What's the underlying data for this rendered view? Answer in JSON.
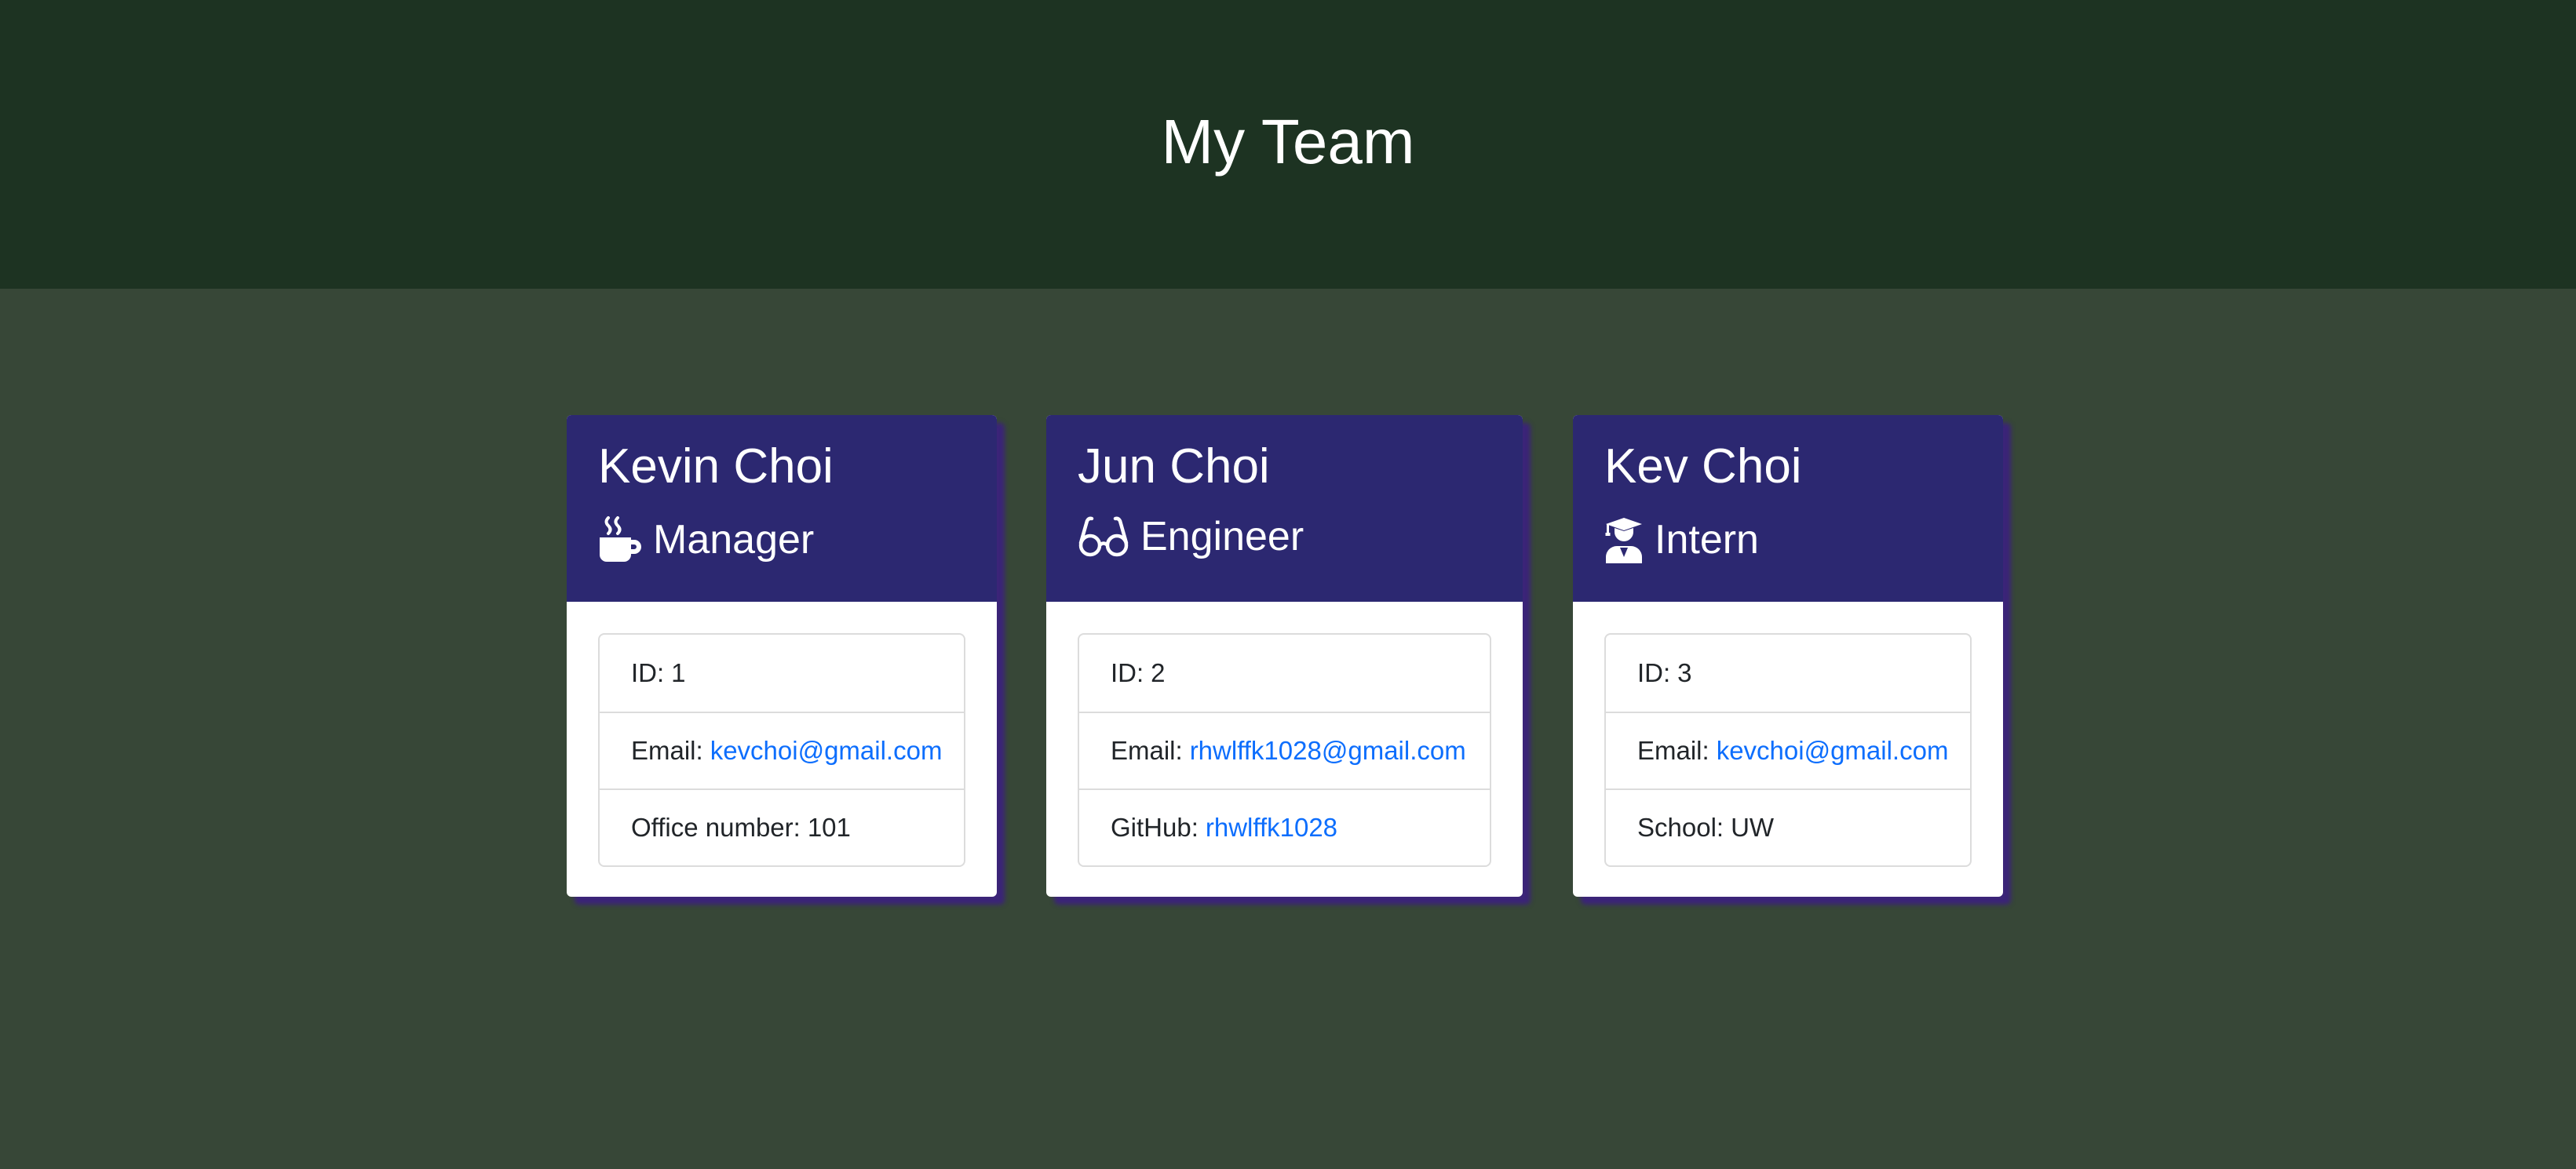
{
  "header": {
    "title": "My Team"
  },
  "cards": [
    {
      "name": "Kevin Choi",
      "role": "Manager",
      "role_icon": "mug-hot-icon",
      "id_label": "ID:",
      "id_value": "1",
      "email_label": "Email:",
      "email_value": "kevchoi@gmail.com",
      "extra_label": "Office number:",
      "extra_value": "101"
    },
    {
      "name": "Jun Choi",
      "role": "Engineer",
      "role_icon": "glasses-icon",
      "id_label": "ID:",
      "id_value": "2",
      "email_label": "Email:",
      "email_value": "rhwlffk1028@gmail.com",
      "extra_label": "GitHub:",
      "extra_value": "rhwlffk1028"
    },
    {
      "name": "Kev Choi",
      "role": "Intern",
      "role_icon": "user-graduate-icon",
      "id_label": "ID:",
      "id_value": "3",
      "email_label": "Email:",
      "email_value": "kevchoi@gmail.com",
      "extra_label": "School:",
      "extra_value": "UW"
    }
  ],
  "colors": {
    "page_bg": "#374737",
    "header_bg": "#1d3322",
    "card_header_bg": "#2c2871",
    "card_shadow": "#3b2478",
    "link": "#0d6efd"
  }
}
